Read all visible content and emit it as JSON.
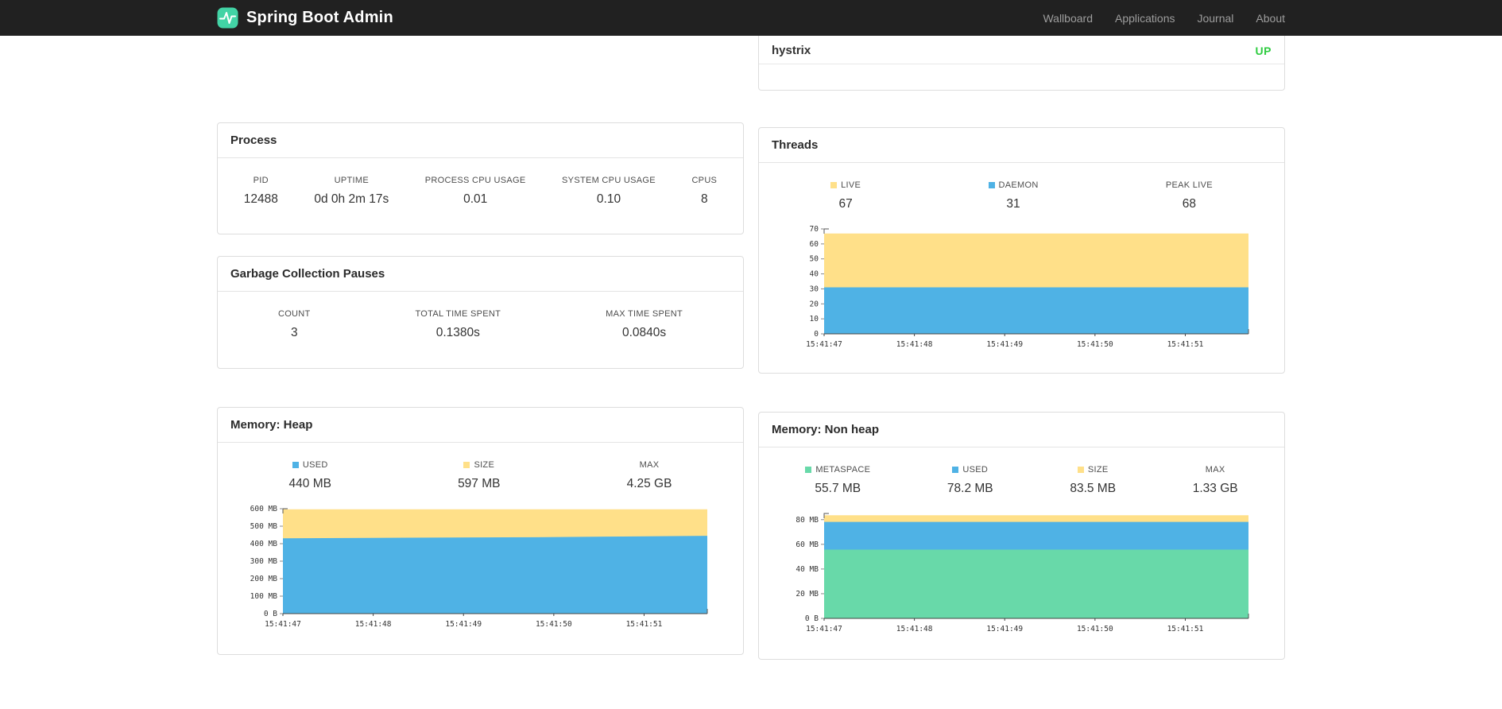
{
  "navbar": {
    "brand": "Spring Boot Admin",
    "links": [
      "Wallboard",
      "Applications",
      "Journal",
      "About"
    ]
  },
  "application": {
    "name": "hystrix",
    "status": "UP"
  },
  "colors": {
    "up_green": "#2ecc40",
    "series_yellow": "#ffe089",
    "series_blue": "#4fb2e5",
    "series_green": "#68d9a9",
    "brand_teal": "#42d3a5"
  },
  "panels": {
    "process": {
      "title": "Process",
      "stats": [
        {
          "label": "PID",
          "value": "12488"
        },
        {
          "label": "UPTIME",
          "value": "0d 0h 2m 17s"
        },
        {
          "label": "PROCESS CPU USAGE",
          "value": "0.01"
        },
        {
          "label": "SYSTEM CPU USAGE",
          "value": "0.10"
        },
        {
          "label": "CPUS",
          "value": "8"
        }
      ]
    },
    "gc": {
      "title": "Garbage Collection Pauses",
      "stats": [
        {
          "label": "COUNT",
          "value": "3"
        },
        {
          "label": "TOTAL TIME SPENT",
          "value": "0.1380s"
        },
        {
          "label": "MAX TIME SPENT",
          "value": "0.0840s"
        }
      ]
    },
    "threads": {
      "title": "Threads",
      "legend": [
        {
          "label": "LIVE",
          "value": "67",
          "color": "#ffe089"
        },
        {
          "label": "DAEMON",
          "value": "31",
          "color": "#4fb2e5"
        },
        {
          "label": "PEAK LIVE",
          "value": "68"
        }
      ]
    },
    "heap": {
      "title": "Memory: Heap",
      "legend": [
        {
          "label": "USED",
          "value": "440 MB",
          "color": "#4fb2e5"
        },
        {
          "label": "SIZE",
          "value": "597 MB",
          "color": "#ffe089"
        },
        {
          "label": "MAX",
          "value": "4.25 GB"
        }
      ]
    },
    "nonheap": {
      "title": "Memory: Non heap",
      "legend": [
        {
          "label": "METASPACE",
          "value": "55.7 MB",
          "color": "#68d9a9"
        },
        {
          "label": "USED",
          "value": "78.2 MB",
          "color": "#4fb2e5"
        },
        {
          "label": "SIZE",
          "value": "83.5 MB",
          "color": "#ffe089"
        },
        {
          "label": "MAX",
          "value": "1.33 GB"
        }
      ]
    }
  },
  "chart_data": [
    {
      "id": "threads",
      "type": "area",
      "stacked": true,
      "paint_order": "back-to-front",
      "x": [
        "15:41:47",
        "15:41:48",
        "15:41:49",
        "15:41:50",
        "15:41:51"
      ],
      "ylim": [
        0,
        70
      ],
      "yticks": [
        {
          "v": 0,
          "label": "0"
        },
        {
          "v": 10,
          "label": "10"
        },
        {
          "v": 20,
          "label": "20"
        },
        {
          "v": 30,
          "label": "30"
        },
        {
          "v": 40,
          "label": "40"
        },
        {
          "v": 50,
          "label": "50"
        },
        {
          "v": 60,
          "label": "60"
        },
        {
          "v": 70,
          "label": "70"
        }
      ],
      "series": [
        {
          "name": "LIVE",
          "color": "#ffe089",
          "values": [
            67,
            67,
            67,
            67,
            67,
            67
          ]
        },
        {
          "name": "DAEMON",
          "color": "#4fb2e5",
          "values": [
            31,
            31,
            31,
            31,
            31,
            31
          ]
        }
      ]
    },
    {
      "id": "heap",
      "type": "area",
      "stacked": true,
      "paint_order": "back-to-front",
      "unit": "MB",
      "x": [
        "15:41:47",
        "15:41:48",
        "15:41:49",
        "15:41:50",
        "15:41:51"
      ],
      "ylim": [
        0,
        600
      ],
      "yticks": [
        {
          "v": 0,
          "label": "0 B"
        },
        {
          "v": 100,
          "label": "100 MB"
        },
        {
          "v": 200,
          "label": "200 MB"
        },
        {
          "v": 300,
          "label": "300 MB"
        },
        {
          "v": 400,
          "label": "400 MB"
        },
        {
          "v": 500,
          "label": "500 MB"
        },
        {
          "v": 600,
          "label": "600 MB"
        }
      ],
      "series": [
        {
          "name": "SIZE",
          "color": "#ffe089",
          "values": [
            597,
            597,
            597,
            597,
            597,
            597
          ]
        },
        {
          "name": "USED",
          "color": "#4fb2e5",
          "values": [
            431,
            433,
            435,
            437,
            441,
            445
          ]
        }
      ]
    },
    {
      "id": "nonheap",
      "type": "area",
      "stacked": true,
      "paint_order": "back-to-front",
      "unit": "MB",
      "x": [
        "15:41:47",
        "15:41:48",
        "15:41:49",
        "15:41:50",
        "15:41:51"
      ],
      "ylim": [
        0,
        85
      ],
      "yticks": [
        {
          "v": 0,
          "label": "0 B"
        },
        {
          "v": 20,
          "label": "20 MB"
        },
        {
          "v": 40,
          "label": "40 MB"
        },
        {
          "v": 60,
          "label": "60 MB"
        },
        {
          "v": 80,
          "label": "80 MB"
        }
      ],
      "series": [
        {
          "name": "SIZE",
          "color": "#ffe089",
          "values": [
            83.5,
            83.5,
            83.5,
            83.5,
            83.5,
            83.5
          ]
        },
        {
          "name": "USED",
          "color": "#4fb2e5",
          "values": [
            78.2,
            78.2,
            78.2,
            78.2,
            78.2,
            78.2
          ]
        },
        {
          "name": "METASPACE",
          "color": "#68d9a9",
          "values": [
            55.7,
            55.7,
            55.7,
            55.7,
            55.7,
            55.7
          ]
        }
      ]
    }
  ]
}
